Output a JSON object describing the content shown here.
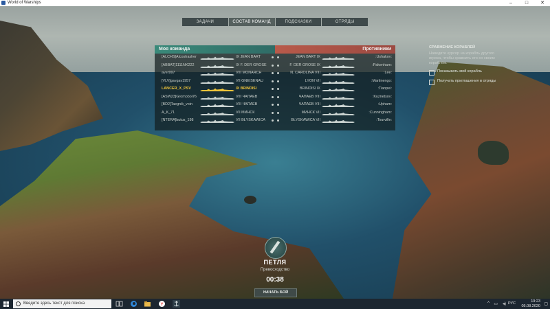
{
  "window": {
    "title": "World of Warships"
  },
  "nav": {
    "tabs": [
      "ЗАДАЧИ",
      "СОСТАВ КОМАНД",
      "ПОДСКАЗКИ",
      "ОТРЯДЫ"
    ]
  },
  "my_team": {
    "header": "Моя команда",
    "rows": [
      {
        "player": "[ALCHS]Alcostrasher",
        "ship": "IX JEAN BART"
      },
      {
        "player": "[ABBAT]1111NK222",
        "ship": "IX F. DER GROSE"
      },
      {
        "player": "aver997",
        "ship": "VIII MONARCH"
      },
      {
        "player": "[VLV]gavgav1957",
        "ship": "VII GNEISENAU"
      },
      {
        "player": "LANCER_X_PSV",
        "ship": "IX BRINDISI",
        "me": true
      },
      {
        "player": "[ASW23]Gromoboi76",
        "ship": "VIII ЧАПАЕВ"
      },
      {
        "player": "[BD2]Taegnik_voin",
        "ship": "VIII ЧАПАЕВ"
      },
      {
        "player": "A_K_71",
        "ship": "VII МИНСК"
      },
      {
        "player": "[NTERA]butus_198",
        "ship": "VII BŁYSKAWICA"
      }
    ]
  },
  "enemy_team": {
    "header": "Противники",
    "rows": [
      {
        "ship": "JEAN BART IX",
        "player": ":Ushakov:"
      },
      {
        "ship": "F. DER GROSE IX",
        "player": ":Pakenham:"
      },
      {
        "ship": "N. CAROLINA VIII",
        "player": ":Lee:"
      },
      {
        "ship": "LYON VII",
        "player": ":Martinengo:"
      },
      {
        "ship": "BRINDISI IX",
        "player": ":Tianpei:"
      },
      {
        "ship": "ЧАПАЕВ VIII",
        "player": ":Kuznetsov:"
      },
      {
        "ship": "ЧАПАЕВ VIII",
        "player": ":Upham:"
      },
      {
        "ship": "МИНСК VII",
        "player": ":Cunningham:"
      },
      {
        "ship": "BŁYSKAWICA VII",
        "player": ":Tourville:"
      }
    ]
  },
  "compare": {
    "title": "СРАВНЕНИЕ КОРАБЛЕЙ",
    "desc": "Наведите курсор на корабль другого игрока, чтобы сравнить его со своим кораблём.",
    "opt1": "Показывать мой корабль",
    "opt2": "Получать приглашения в отряды"
  },
  "battle": {
    "map": "ПЕТЛЯ",
    "mode": "Превосходство",
    "timer": "00:38",
    "button": "НАЧАТЬ БОЙ"
  },
  "taskbar": {
    "search_placeholder": "Введите здесь текст для поиска",
    "lang": "РУС",
    "time": "19:23",
    "date": "05.08.2020"
  },
  "colors": {
    "my_team": "#3a8a7a",
    "enemy_team": "#b85a4a",
    "player_highlight": "#f0c53a"
  }
}
